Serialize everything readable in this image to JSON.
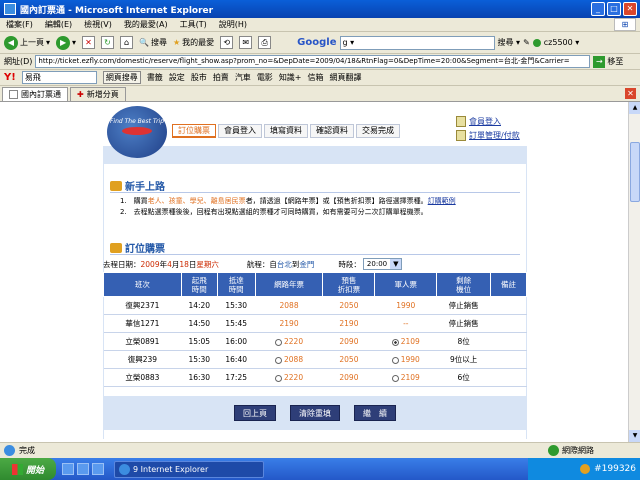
{
  "window": {
    "title": "國內訂票通 - Microsoft Internet Explorer"
  },
  "menu": [
    "檔案(F)",
    "編輯(E)",
    "檢視(V)",
    "我的最愛(A)",
    "工具(T)",
    "說明(H)"
  ],
  "toolbar": {
    "back": "上一頁",
    "search": "搜尋",
    "favorites": "我的最愛",
    "google_logo": "Google",
    "google_value": "g ▾",
    "google_search": "搜尋 ▾",
    "account": "cz5500 ▾"
  },
  "address": {
    "label": "網址(D)",
    "url": "http://ticket.ezfly.com/domestic/reserve/flight_show.asp?prom_no=&DepDate=2009/04/18&RtnFlag=0&DepTime=20:00&Segment=台北-金門&Carrier=",
    "go": "移至"
  },
  "yahoo": {
    "logo": "Y!",
    "query": "易飛",
    "web_search": "網頁搜尋",
    "items": [
      "書籤",
      "設定",
      "股市",
      "拍賣",
      "汽車",
      "電影",
      "知識+",
      "信箱",
      "網頁翻譯"
    ]
  },
  "tabs": {
    "current": "國內訂票通",
    "new_tab": "新增分頁"
  },
  "page": {
    "logo_text": "Find The Best Trip",
    "steps": [
      "訂位購票",
      "會員登入",
      "填寫資料",
      "確認資料",
      "交易完成"
    ],
    "side_links": [
      "會員登入",
      "訂單管理/付款"
    ],
    "guide": {
      "title": "新手上路",
      "line1_a": "1.　購買",
      "line1_highlight": "老人、孩童、學兒、離島居民票",
      "line1_b": "者，請透過【網路年票】或【預售折扣票】路徑選擇票種。",
      "line1_link": "訂購範例",
      "line2": "2.　去程點選票種後後，回程有出現點選組的票種才可同時購買，如有需要可分二次訂購單程機票。"
    },
    "booking": {
      "title": "訂位購票",
      "date_label": "去程日期：",
      "year": "2009",
      "year_unit": "年",
      "month": "4",
      "month_unit": "月",
      "day": "18",
      "day_unit": "日",
      "weekday": "星期六",
      "route_label": "航程：自",
      "from": "台北",
      "to_label": "到",
      "to": "金門",
      "time_label": "時段：",
      "time_value": "20:00"
    },
    "table": {
      "headers": [
        "班次",
        "起飛\n時間",
        "抵達\n時間",
        "網路年票",
        "預售\n折扣票",
        "軍人票",
        "剩餘\n機位",
        "備註"
      ],
      "rows": [
        {
          "flight": "復興2371",
          "dep": "14:20",
          "arr": "15:30",
          "net": "2088",
          "pre": "2050",
          "mil": "1990",
          "seats": "停止銷售",
          "note": "",
          "net_radio": false,
          "pre_radio": false,
          "mil_radio": false
        },
        {
          "flight": "華信1271",
          "dep": "14:50",
          "arr": "15:45",
          "net": "2190",
          "pre": "2190",
          "mil": "--",
          "seats": "停止銷售",
          "note": "",
          "net_radio": false,
          "pre_radio": false,
          "mil_radio": false
        },
        {
          "flight": "立榮0891",
          "dep": "15:05",
          "arr": "16:00",
          "net": "2220",
          "pre": "2090",
          "mil": "2109",
          "seats": "8位",
          "note": "",
          "net_radio": true,
          "pre_radio": false,
          "mil_radio": true
        },
        {
          "flight": "復興239",
          "dep": "15:30",
          "arr": "16:40",
          "net": "2088",
          "pre": "2050",
          "mil": "1990",
          "seats": "9位以上",
          "note": "",
          "net_radio": true,
          "pre_radio": false,
          "mil_radio": true
        },
        {
          "flight": "立榮0883",
          "dep": "16:30",
          "arr": "17:25",
          "net": "2220",
          "pre": "2090",
          "mil": "2109",
          "seats": "6位",
          "note": "",
          "net_radio": true,
          "pre_radio": false,
          "mil_radio": true
        }
      ]
    },
    "buttons": [
      "回上頁",
      "清除重填",
      "繼　續"
    ]
  },
  "status": {
    "text": "完成",
    "zone": "網際網路"
  },
  "taskbar": {
    "start": "開始",
    "task": "9 Internet Explorer",
    "tray_text": "#199326"
  }
}
